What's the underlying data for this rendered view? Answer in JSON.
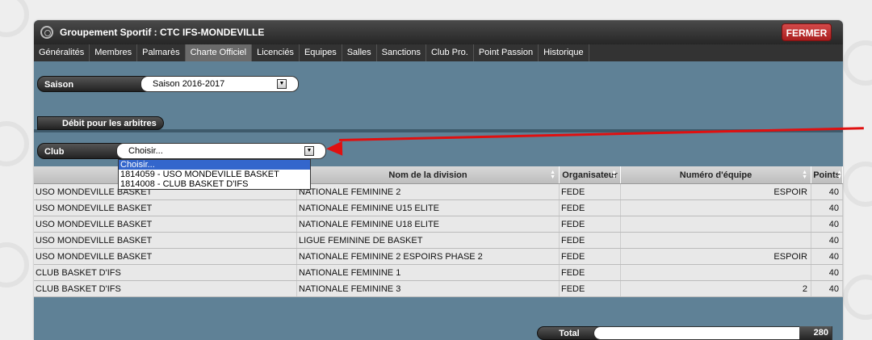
{
  "window": {
    "title": "Groupement Sportif : CTC IFS-MONDEVILLE",
    "close_label": "FERMER"
  },
  "tabs": [
    {
      "label": "Généralités"
    },
    {
      "label": "Membres"
    },
    {
      "label": "Palmarès"
    },
    {
      "label": "Charte Officiel",
      "active": true
    },
    {
      "label": "Licenciés"
    },
    {
      "label": "Equipes"
    },
    {
      "label": "Salles"
    },
    {
      "label": "Sanctions"
    },
    {
      "label": "Club Pro."
    },
    {
      "label": "Point Passion"
    },
    {
      "label": "Historique"
    }
  ],
  "saison": {
    "label": "Saison",
    "value": "Saison 2016-2017"
  },
  "section": {
    "title": "Débit pour les arbitres"
  },
  "club": {
    "label": "Club",
    "value": "Choisir...",
    "options": [
      {
        "label": "Choisir...",
        "selected": true
      },
      {
        "label": "1814059 - USO MONDEVILLE BASKET"
      },
      {
        "label": "1814008 - CLUB BASKET D'IFS"
      }
    ]
  },
  "table": {
    "columns": [
      "",
      "Nom de la division",
      "Organisateur",
      "Numéro d'équipe",
      "Points"
    ],
    "rows": [
      [
        "USO MONDEVILLE BASKET",
        "NATIONALE FEMININE 2",
        "FEDE",
        "ESPOIR",
        "40"
      ],
      [
        "USO MONDEVILLE BASKET",
        "NATIONALE FEMININE U15 ELITE",
        "FEDE",
        "",
        "40"
      ],
      [
        "USO MONDEVILLE BASKET",
        "NATIONALE FEMININE U18 ELITE",
        "FEDE",
        "",
        "40"
      ],
      [
        "USO MONDEVILLE BASKET",
        "LIGUE FEMININE DE BASKET",
        "FEDE",
        "",
        "40"
      ],
      [
        "USO MONDEVILLE BASKET",
        "NATIONALE FEMININE 2 ESPOIRS PHASE 2",
        "FEDE",
        "ESPOIR",
        "40"
      ],
      [
        "CLUB BASKET D'IFS",
        "NATIONALE FEMININE 1",
        "FEDE",
        "",
        "40"
      ],
      [
        "CLUB BASKET D'IFS",
        "NATIONALE FEMININE 3",
        "FEDE",
        "2",
        "40"
      ]
    ]
  },
  "total": {
    "label": "Total",
    "value": "280"
  },
  "colors": {
    "accent_red": "#e01010",
    "panel": "#5f8196",
    "close_button": "#c03030"
  }
}
